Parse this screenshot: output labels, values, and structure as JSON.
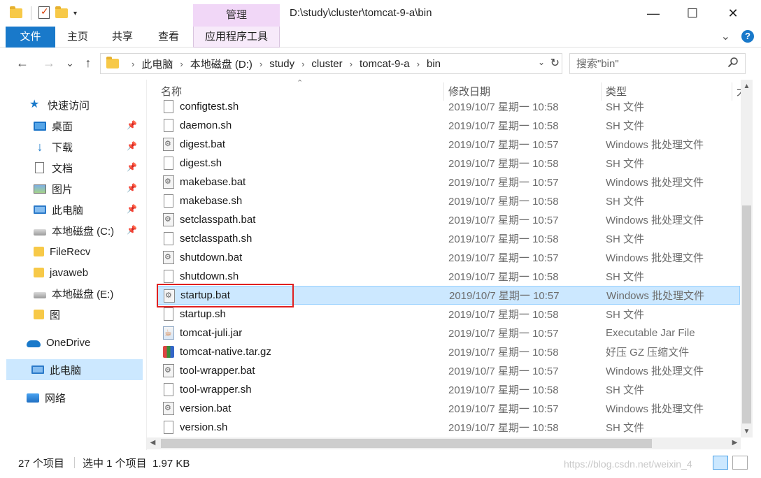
{
  "window": {
    "title": "D:\\study\\cluster\\tomcat-9-a\\bin",
    "context_tab": "管理",
    "controls": {
      "minimize": "—",
      "maximize": "☐",
      "close": "✕"
    }
  },
  "ribbon": {
    "tabs": [
      "文件",
      "主页",
      "共享",
      "查看",
      "应用程序工具"
    ],
    "chevron": "⌄",
    "help": "?"
  },
  "nav": {
    "back": "←",
    "forward": "→",
    "recent": "⌄",
    "up": "↑",
    "breadcrumb": [
      "此电脑",
      "本地磁盘 (D:)",
      "study",
      "cluster",
      "tomcat-9-a",
      "bin"
    ],
    "breadcrumb_sep": "›",
    "dropdown": "⌄",
    "refresh": "↻",
    "search_placeholder": "搜索\"bin\""
  },
  "sidebar": {
    "items": [
      {
        "label": "快速访问",
        "icon": "star-icon",
        "pinned": false
      },
      {
        "label": "桌面",
        "icon": "desktop-icon",
        "pinned": true
      },
      {
        "label": "下载",
        "icon": "download-icon",
        "pinned": true
      },
      {
        "label": "文档",
        "icon": "document-icon",
        "pinned": true
      },
      {
        "label": "图片",
        "icon": "pictures-icon",
        "pinned": true
      },
      {
        "label": "此电脑",
        "icon": "computer-icon",
        "pinned": true
      },
      {
        "label": "本地磁盘 (C:)",
        "icon": "drive-icon",
        "pinned": true
      },
      {
        "label": "FileRecv",
        "icon": "folder-icon",
        "pinned": false
      },
      {
        "label": "javaweb",
        "icon": "folder-icon",
        "pinned": false
      },
      {
        "label": "本地磁盘 (E:)",
        "icon": "drive-icon",
        "pinned": false
      },
      {
        "label": "图",
        "icon": "folder-icon",
        "pinned": false
      },
      {
        "label": "OneDrive",
        "icon": "cloud-icon",
        "pinned": false
      },
      {
        "label": "此电脑",
        "icon": "computer-icon",
        "pinned": false,
        "selected": true
      },
      {
        "label": "网络",
        "icon": "network-icon",
        "pinned": false
      }
    ]
  },
  "list": {
    "columns": [
      "名称",
      "修改日期",
      "类型"
    ],
    "extra_column": "大",
    "files": [
      {
        "name": "configtest.sh",
        "date": "2019/10/7 星期一 10:58",
        "type": "SH 文件",
        "icon": "sh"
      },
      {
        "name": "daemon.sh",
        "date": "2019/10/7 星期一 10:58",
        "type": "SH 文件",
        "icon": "sh"
      },
      {
        "name": "digest.bat",
        "date": "2019/10/7 星期一 10:57",
        "type": "Windows 批处理文件",
        "icon": "bat"
      },
      {
        "name": "digest.sh",
        "date": "2019/10/7 星期一 10:58",
        "type": "SH 文件",
        "icon": "sh"
      },
      {
        "name": "makebase.bat",
        "date": "2019/10/7 星期一 10:57",
        "type": "Windows 批处理文件",
        "icon": "bat"
      },
      {
        "name": "makebase.sh",
        "date": "2019/10/7 星期一 10:58",
        "type": "SH 文件",
        "icon": "sh"
      },
      {
        "name": "setclasspath.bat",
        "date": "2019/10/7 星期一 10:57",
        "type": "Windows 批处理文件",
        "icon": "bat"
      },
      {
        "name": "setclasspath.sh",
        "date": "2019/10/7 星期一 10:58",
        "type": "SH 文件",
        "icon": "sh"
      },
      {
        "name": "shutdown.bat",
        "date": "2019/10/7 星期一 10:57",
        "type": "Windows 批处理文件",
        "icon": "bat"
      },
      {
        "name": "shutdown.sh",
        "date": "2019/10/7 星期一 10:58",
        "type": "SH 文件",
        "icon": "sh"
      },
      {
        "name": "startup.bat",
        "date": "2019/10/7 星期一 10:57",
        "type": "Windows 批处理文件",
        "icon": "bat",
        "selected": true
      },
      {
        "name": "startup.sh",
        "date": "2019/10/7 星期一 10:58",
        "type": "SH 文件",
        "icon": "sh"
      },
      {
        "name": "tomcat-juli.jar",
        "date": "2019/10/7 星期一 10:57",
        "type": "Executable Jar File",
        "icon": "jar"
      },
      {
        "name": "tomcat-native.tar.gz",
        "date": "2019/10/7 星期一 10:58",
        "type": "好压 GZ 压缩文件",
        "icon": "gz"
      },
      {
        "name": "tool-wrapper.bat",
        "date": "2019/10/7 星期一 10:57",
        "type": "Windows 批处理文件",
        "icon": "bat"
      },
      {
        "name": "tool-wrapper.sh",
        "date": "2019/10/7 星期一 10:58",
        "type": "SH 文件",
        "icon": "sh"
      },
      {
        "name": "version.bat",
        "date": "2019/10/7 星期一 10:57",
        "type": "Windows 批处理文件",
        "icon": "bat"
      },
      {
        "name": "version.sh",
        "date": "2019/10/7 星期一 10:58",
        "type": "SH 文件",
        "icon": "sh"
      }
    ]
  },
  "status": {
    "item_count": "27 个项目",
    "selection": "选中 1 个项目  1.97 KB",
    "watermark": "https://blog.csdn.net/weixin_4"
  },
  "colors": {
    "accent": "#1979ca",
    "selection": "#cce8ff",
    "manage_tab": "#f1d7f7",
    "highlight_border": "#e02020"
  }
}
